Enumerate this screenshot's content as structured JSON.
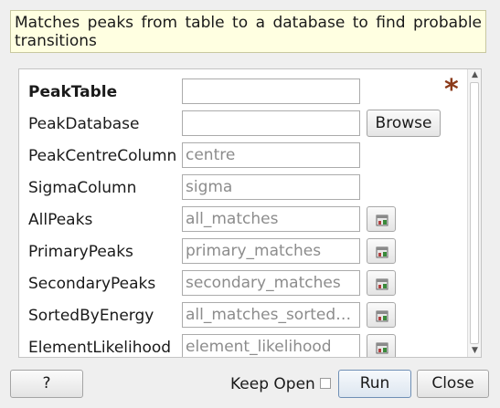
{
  "description": "Matches peaks from table to a database to find probable transitions",
  "properties": [
    {
      "label": "PeakTable",
      "value": "",
      "placeholder": "",
      "mandatory": true
    },
    {
      "label": "PeakDatabase",
      "value": "",
      "placeholder": "",
      "button": "Browse"
    },
    {
      "label": "PeakCentreColumn",
      "value": "",
      "placeholder": "centre"
    },
    {
      "label": "SigmaColumn",
      "value": "",
      "placeholder": "sigma"
    },
    {
      "label": "AllPeaks",
      "value": "",
      "placeholder": "all_matches",
      "icon": "workspace-icon"
    },
    {
      "label": "PrimaryPeaks",
      "value": "",
      "placeholder": "primary_matches",
      "icon": "workspace-icon"
    },
    {
      "label": "SecondaryPeaks",
      "value": "",
      "placeholder": "secondary_matches",
      "icon": "workspace-icon"
    },
    {
      "label": "SortedByEnergy",
      "value": "",
      "placeholder": "all_matches_sorted_by_energy",
      "icon": "workspace-icon"
    },
    {
      "label": "ElementLikelihood",
      "value": "",
      "placeholder": "element_likelihood",
      "icon": "workspace-icon"
    }
  ],
  "mandatory_marker": "*",
  "footer": {
    "help_label": "?",
    "keep_open_label": "Keep Open",
    "keep_open_checked": false,
    "run_label": "Run",
    "close_label": "Close"
  },
  "colors": {
    "description_bg": "#ffffe1",
    "mandatory_star": "#8b3a1a"
  }
}
